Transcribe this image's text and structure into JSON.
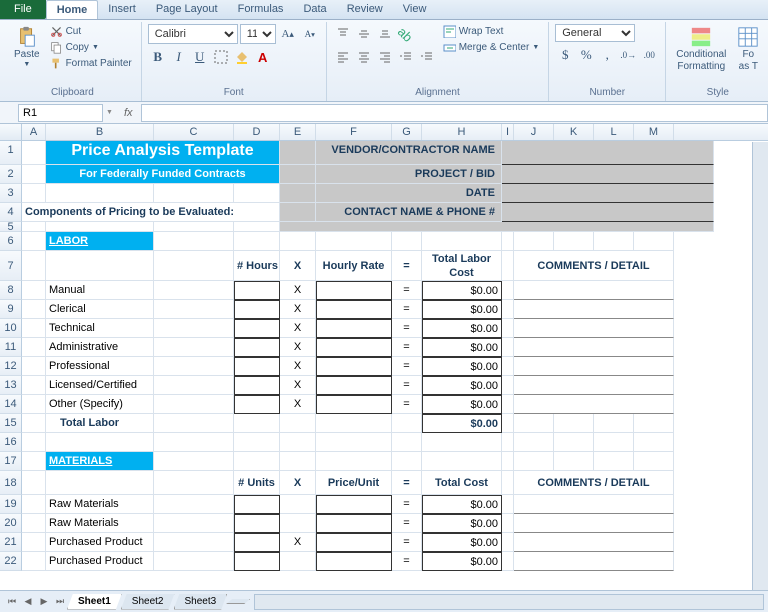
{
  "tabs": {
    "file": "File",
    "home": "Home",
    "insert": "Insert",
    "pagelayout": "Page Layout",
    "formulas": "Formulas",
    "data": "Data",
    "review": "Review",
    "view": "View"
  },
  "ribbon": {
    "paste": "Paste",
    "cut": "Cut",
    "copy": "Copy",
    "fmtpainter": "Format Painter",
    "clipboard": "Clipboard",
    "font": "Calibri",
    "size": "11",
    "fontgrp": "Font",
    "wrap": "Wrap Text",
    "merge": "Merge & Center",
    "aligngrp": "Alignment",
    "numfmt": "General",
    "numgrp": "Number",
    "cond": "Conditional",
    "cond2": "Formatting",
    "fmtas": "Fo",
    "fmtas2": "as T",
    "stylegrp": "Style"
  },
  "namebox": "R1",
  "cols": [
    "A",
    "B",
    "C",
    "D",
    "E",
    "F",
    "G",
    "H",
    "I",
    "J",
    "K",
    "L",
    "M"
  ],
  "doc": {
    "title": "Price Analysis Template",
    "subtitle": "For Federally Funded Contracts",
    "components": "Components of Pricing to be Evaluated:",
    "vendor": "VENDOR/CONTRACTOR NAME",
    "project": "PROJECT / BID",
    "date": "DATE",
    "contact": "CONTACT NAME & PHONE #",
    "labor": "LABOR",
    "materials": "MATERIALS",
    "hours": "# Hours",
    "units": "# Units",
    "x": "X",
    "hourly": "Hourly Rate",
    "priceunit": "Price/Unit",
    "eq": "=",
    "tlc1": "Total Labor",
    "tlc2": "Cost",
    "totalcost": "Total Cost",
    "comments": "COMMENTS / DETAIL",
    "rows": {
      "manual": "Manual",
      "clerical": "Clerical",
      "technical": "Technical",
      "admin": "Administrative",
      "prof": "Professional",
      "lic": "Licensed/Certified",
      "other": "Other (Specify)",
      "totallabor": "Total Labor",
      "raw": "Raw Materials",
      "purchased": "Purchased Product"
    },
    "zero": "$0.00"
  },
  "sheets": {
    "s1": "Sheet1",
    "s2": "Sheet2",
    "s3": "Sheet3"
  }
}
